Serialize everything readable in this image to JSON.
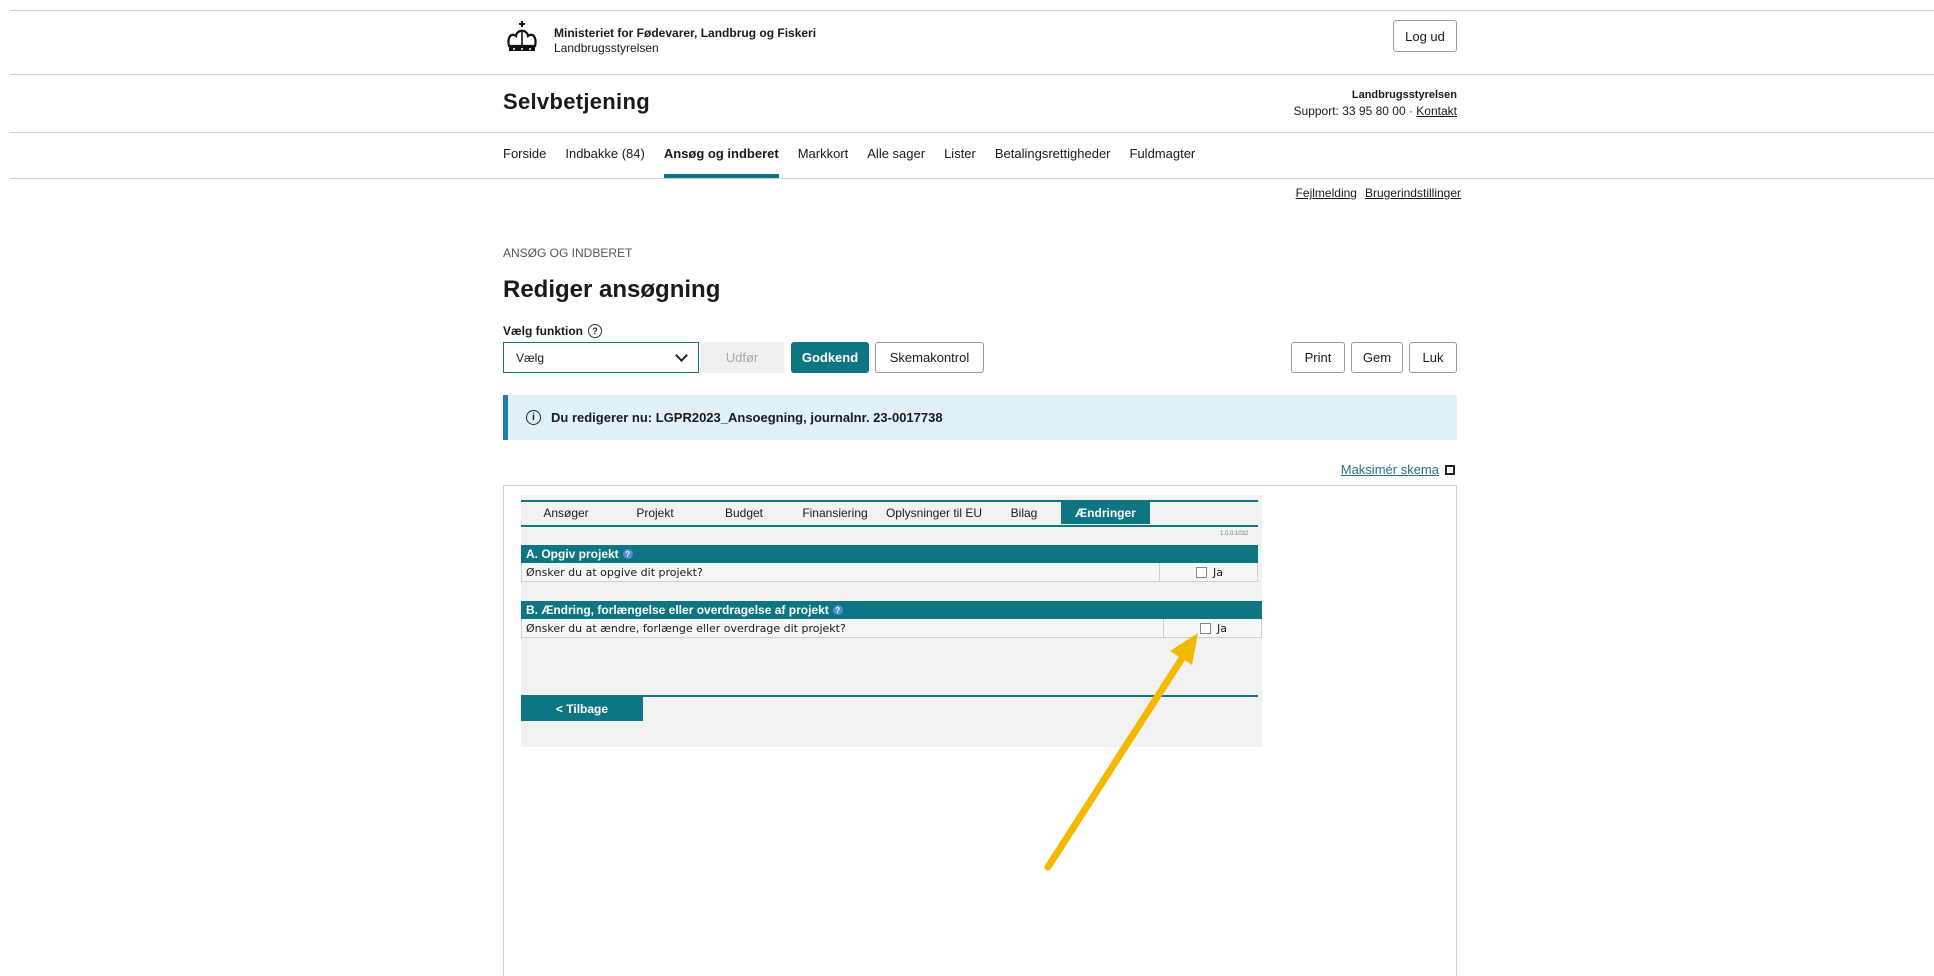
{
  "header": {
    "ministry_name": "Ministeriet for Fødevarer, Landbrug og Fiskeri",
    "ministry_sub": "Landbrugsstyrelsen",
    "logout_label": "Log ud",
    "app_title": "Selvbetjening",
    "org_name": "Landbrugsstyrelsen",
    "support_text": "Support: 33 95 80 00 · ",
    "contact_link": "Kontakt"
  },
  "nav": {
    "items": [
      {
        "label": "Forside"
      },
      {
        "label": "Indbakke (84)"
      },
      {
        "label": "Ansøg og indberet"
      },
      {
        "label": "Markkort"
      },
      {
        "label": "Alle sager"
      },
      {
        "label": "Lister"
      },
      {
        "label": "Betalingsrettigheder"
      },
      {
        "label": "Fuldmagter"
      }
    ],
    "active_index": 2
  },
  "util_links": {
    "error_report": "Fejlmelding",
    "user_settings": "Brugerindstillinger"
  },
  "breadcrumb": "ANSØG OG INDBERET",
  "page_title": "Rediger ansøgning",
  "toolbar": {
    "function_label": "Vælg funktion",
    "select_value": "Vælg",
    "execute_label": "Udfør",
    "approve_label": "Godkend",
    "schema_check_label": "Skemakontrol",
    "print_label": "Print",
    "save_label": "Gem",
    "close_label": "Luk"
  },
  "info_banner": "Du redigerer nu: LGPR2023_Ansoegning, journalnr. 23-0017738",
  "maximize_label": "Maksimér skema",
  "form": {
    "tabs": [
      "Ansøger",
      "Projekt",
      "Budget",
      "Finansiering",
      "Oplysninger til EU",
      "Bilag",
      "Ændringer"
    ],
    "active_tab_index": 6,
    "version": "1.0.0.1032",
    "section_a": {
      "title": "A. Opgiv projekt",
      "question": "Ønsker du at opgive dit projekt?",
      "option": "Ja",
      "checked": false
    },
    "section_b": {
      "title": "B. Ændring, forlængelse eller overdragelse af projekt",
      "question": "Ønsker du at ændre, forlænge eller overdrage dit projekt?",
      "option": "Ja",
      "checked": false
    },
    "back_label": "< Tilbage"
  },
  "colors": {
    "primary": "#0e7683",
    "banner_bg": "#e0f1f8",
    "banner_border": "#2478b5",
    "arrow": "#f5b800"
  }
}
